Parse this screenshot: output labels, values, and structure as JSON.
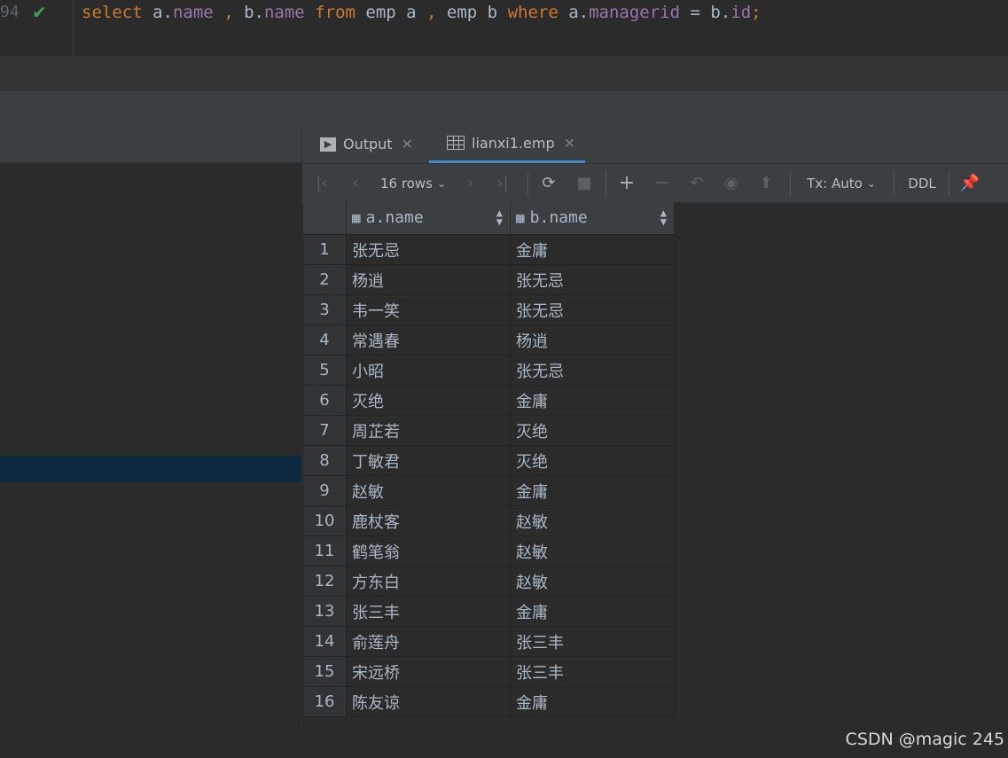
{
  "editor": {
    "line_number": "94",
    "code_tokens": [
      {
        "t": "select",
        "c": "kw"
      },
      {
        "t": " a.",
        "c": "plain"
      },
      {
        "t": "name",
        "c": "fld"
      },
      {
        "t": " ",
        "c": "plain"
      },
      {
        "t": ",",
        "c": "kw"
      },
      {
        "t": " b.",
        "c": "plain"
      },
      {
        "t": "name",
        "c": "fld"
      },
      {
        "t": " ",
        "c": "plain"
      },
      {
        "t": "from",
        "c": "kw"
      },
      {
        "t": " emp a ",
        "c": "plain"
      },
      {
        "t": ",",
        "c": "kw"
      },
      {
        "t": " emp b ",
        "c": "plain"
      },
      {
        "t": "where",
        "c": "kw"
      },
      {
        "t": " a.",
        "c": "plain"
      },
      {
        "t": "managerid",
        "c": "fld"
      },
      {
        "t": " = b.",
        "c": "plain"
      },
      {
        "t": "id",
        "c": "fld"
      },
      {
        "t": ";",
        "c": "kw"
      }
    ]
  },
  "tabs": {
    "output_label": "Output",
    "result_label": "lianxi1.emp"
  },
  "toolbar": {
    "rows_label": "16 rows",
    "tx_label": "Tx: Auto",
    "ddl_label": "DDL"
  },
  "grid": {
    "columns": [
      "a.name",
      "b.name"
    ],
    "rows": [
      [
        "1",
        "张无忌",
        "金庸"
      ],
      [
        "2",
        "杨逍",
        "张无忌"
      ],
      [
        "3",
        "韦一笑",
        "张无忌"
      ],
      [
        "4",
        "常遇春",
        "杨逍"
      ],
      [
        "5",
        "小昭",
        "张无忌"
      ],
      [
        "6",
        "灭绝",
        "金庸"
      ],
      [
        "7",
        "周芷若",
        "灭绝"
      ],
      [
        "8",
        "丁敏君",
        "灭绝"
      ],
      [
        "9",
        "赵敏",
        "金庸"
      ],
      [
        "10",
        "鹿杖客",
        "赵敏"
      ],
      [
        "11",
        "鹤笔翁",
        "赵敏"
      ],
      [
        "12",
        "方东白",
        "赵敏"
      ],
      [
        "13",
        "张三丰",
        "金庸"
      ],
      [
        "14",
        "俞莲舟",
        "张三丰"
      ],
      [
        "15",
        "宋远桥",
        "张三丰"
      ],
      [
        "16",
        "陈友谅",
        "金庸"
      ]
    ]
  },
  "watermark": "CSDN @magic 245"
}
